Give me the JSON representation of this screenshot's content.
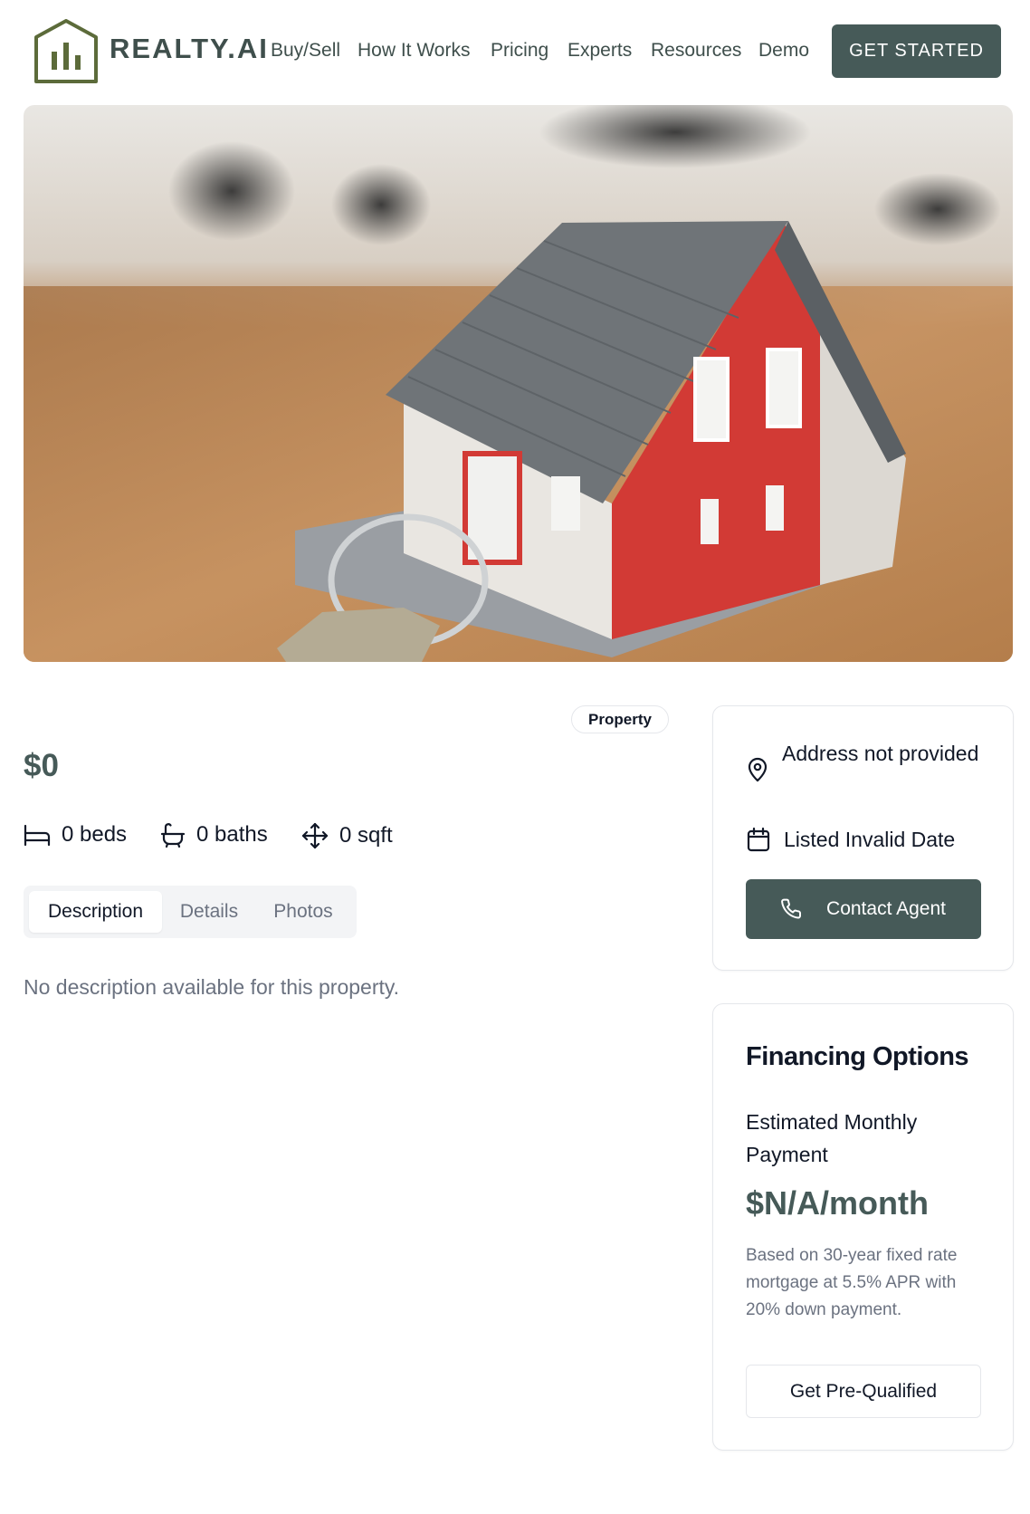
{
  "brand": {
    "name": "REALTY.AI",
    "accent_color": "#465a58",
    "logo_color": "#5c6b3a"
  },
  "nav": {
    "items": [
      "Buy/Sell",
      "How It Works",
      "Pricing",
      "Experts",
      "Resources",
      "Demo"
    ],
    "cta_label": "GET STARTED"
  },
  "hero": {
    "image_subject": "model house with keys on wooden table"
  },
  "property": {
    "badge": "Property",
    "price": "$0",
    "beds": "0 beds",
    "baths": "0 baths",
    "sqft": "0 sqft",
    "icons": [
      "bed-icon",
      "bath-icon",
      "move-icon"
    ]
  },
  "tabs": {
    "items": [
      "Description",
      "Details",
      "Photos"
    ],
    "active": "Description"
  },
  "description": "No description available for this property.",
  "contact_card": {
    "address": "Address not provided",
    "listed": "Listed Invalid Date",
    "contact_label": "Contact Agent",
    "icons": [
      "map-pin-icon",
      "calendar-icon",
      "phone-icon"
    ]
  },
  "financing": {
    "title": "Financing Options",
    "subtitle": "Estimated Monthly Payment",
    "amount": "$N/A/month",
    "note": "Based on 30-year fixed rate mortgage at 5.5% APR with 20% down payment.",
    "button_label": "Get Pre-Qualified"
  }
}
